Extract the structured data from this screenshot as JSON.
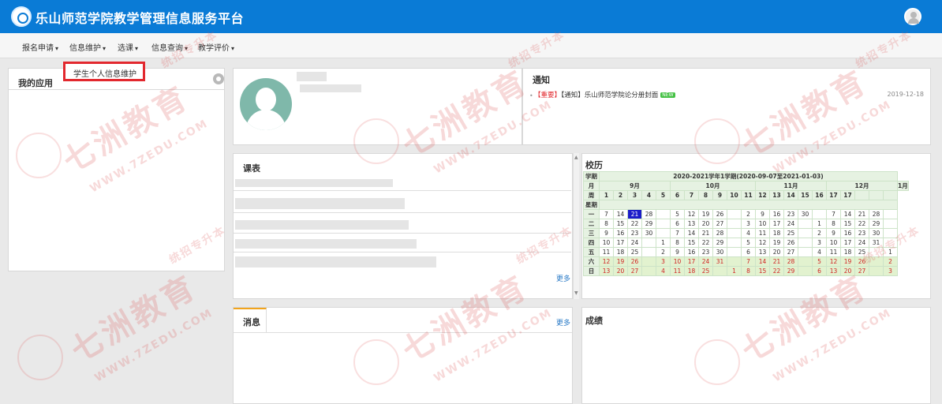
{
  "header": {
    "title": "乐山师范学院教学管理信息服务平台"
  },
  "menu": [
    {
      "label": "报名申请",
      "caret": "▾"
    },
    {
      "label": "信息维护",
      "caret": "▾"
    },
    {
      "label": "选课",
      "caret": "▾"
    },
    {
      "label": "信息查询",
      "caret": "▾"
    },
    {
      "label": "教学评价",
      "caret": "▾"
    }
  ],
  "dropdown": {
    "item": "学生个人信息维护"
  },
  "panels": {
    "apps": "我的应用",
    "notice": "通知",
    "schedule": "课表",
    "calendar": "校历",
    "message": "消息",
    "grades": "成绩"
  },
  "notice": {
    "tag_important": "【重要】",
    "tag_notice": "【通知】",
    "text": "乐山师范学院论分册封面",
    "badge": "NEW",
    "date": "2019-12-18"
  },
  "more_label": "更多",
  "calendar": {
    "header_term": "2020-2021学年1学期(2020-09-07至2021-01-03)",
    "label_term": "学期",
    "label_month": "月",
    "label_week": "周",
    "label_day": "星期",
    "months": [
      {
        "name": "9月",
        "span": 4
      },
      {
        "name": "10月",
        "span": 5
      },
      {
        "name": "11月",
        "span": 4
      },
      {
        "name": "12月",
        "span": 4
      },
      {
        "name": "1月",
        "span": 1
      }
    ],
    "weeks": [
      "1",
      "2",
      "3",
      "4",
      "5",
      "6",
      "7",
      "8",
      "9",
      "10",
      "11",
      "12",
      "13",
      "14",
      "15",
      "16",
      "17",
      "17"
    ],
    "rows": [
      {
        "day": "一",
        "cells": [
          "7",
          "14",
          "21",
          "28",
          "",
          "5",
          "12",
          "19",
          "26",
          "",
          "2",
          "9",
          "16",
          "23",
          "30",
          "",
          "7",
          "14",
          "21",
          "28",
          ""
        ],
        "today": 2
      },
      {
        "day": "二",
        "cells": [
          "8",
          "15",
          "22",
          "29",
          "",
          "6",
          "13",
          "20",
          "27",
          "",
          "3",
          "10",
          "17",
          "24",
          "",
          "1",
          "8",
          "15",
          "22",
          "29",
          ""
        ]
      },
      {
        "day": "三",
        "cells": [
          "9",
          "16",
          "23",
          "30",
          "",
          "7",
          "14",
          "21",
          "28",
          "",
          "4",
          "11",
          "18",
          "25",
          "",
          "2",
          "9",
          "16",
          "23",
          "30",
          ""
        ]
      },
      {
        "day": "四",
        "cells": [
          "10",
          "17",
          "24",
          "",
          "1",
          "8",
          "15",
          "22",
          "29",
          "",
          "5",
          "12",
          "19",
          "26",
          "",
          "3",
          "10",
          "17",
          "24",
          "31",
          ""
        ]
      },
      {
        "day": "五",
        "cells": [
          "11",
          "18",
          "25",
          "",
          "2",
          "9",
          "16",
          "23",
          "30",
          "",
          "6",
          "13",
          "20",
          "27",
          "",
          "4",
          "11",
          "18",
          "25",
          "",
          "1"
        ]
      },
      {
        "day": "六",
        "cells": [
          "12",
          "19",
          "26",
          "",
          "3",
          "10",
          "17",
          "24",
          "31",
          "",
          "7",
          "14",
          "21",
          "28",
          "",
          "5",
          "12",
          "19",
          "26",
          "",
          "2"
        ],
        "weekend": true
      },
      {
        "day": "日",
        "cells": [
          "13",
          "20",
          "27",
          "",
          "4",
          "11",
          "18",
          "25",
          "",
          "1",
          "8",
          "15",
          "22",
          "29",
          "",
          "6",
          "13",
          "20",
          "27",
          "",
          "3"
        ],
        "weekend": true
      }
    ]
  },
  "watermark": {
    "brand": "七洲教育",
    "domain": "WWW.7ZEDU.COM",
    "slogan": "统招专升本"
  }
}
